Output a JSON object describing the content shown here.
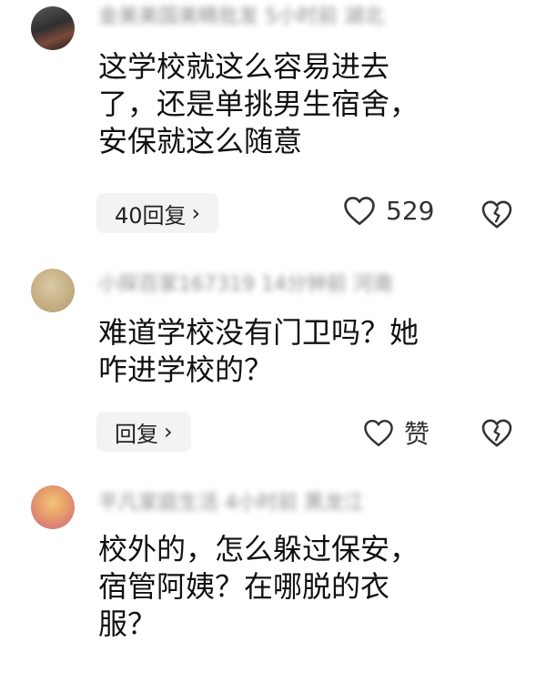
{
  "comments": [
    {
      "meta": "金美美国美睛批发  5小时前  湖北",
      "text": "这学校就这么容易进去\n了，还是单挑男生宿舍，\n安保就这么随意",
      "reply_label": "40回复",
      "like_label": "529"
    },
    {
      "meta": "小探百家167319  14分钟前  河南",
      "text": "难道学校没有门卫吗？她\n咋进学校的？",
      "reply_label": "回复",
      "like_label": "赞"
    },
    {
      "meta": "平凡家庭生活  4小时前  黑龙江",
      "text": "校外的，怎么躲过保安，\n宿管阿姨？在哪脱的衣\n服？"
    }
  ],
  "icons": {
    "chevron": "chevron-right-icon",
    "like": "heart-outline-icon",
    "dislike": "broken-heart-icon"
  },
  "colors": {
    "text": "#111111",
    "meta": "#6a6a6a",
    "button_bg": "#f3f3f3",
    "icon": "#333333"
  }
}
